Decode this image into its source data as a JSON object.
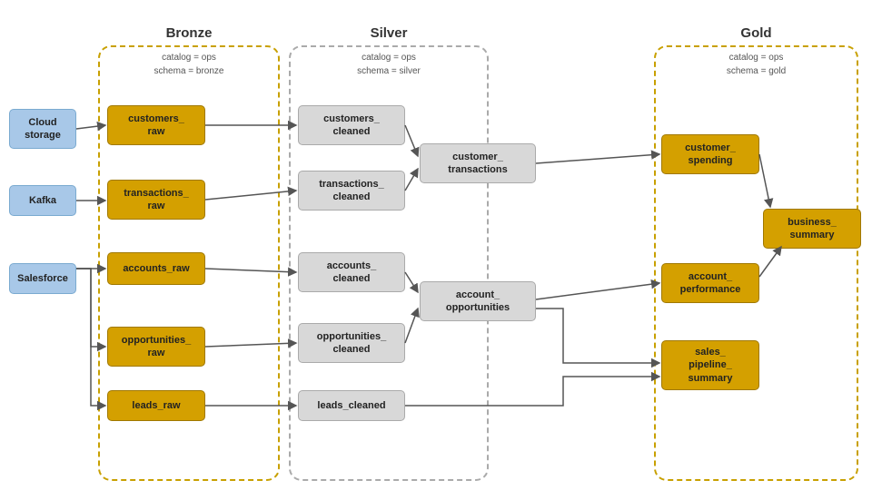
{
  "zones": {
    "bronze": {
      "title": "Bronze",
      "subtitle_line1": "catalog = ops",
      "subtitle_line2": "schema = bronze"
    },
    "silver": {
      "title": "Silver",
      "subtitle_line1": "catalog = ops",
      "subtitle_line2": "schema = silver"
    },
    "gold": {
      "title": "Gold",
      "subtitle_line1": "catalog = ops",
      "subtitle_line2": "schema = gold"
    }
  },
  "sources": [
    {
      "id": "cloud_storage",
      "label": "Cloud\nstorage"
    },
    {
      "id": "kafka",
      "label": "Kafka"
    },
    {
      "id": "salesforce",
      "label": "Salesforce"
    }
  ],
  "bronze_nodes": [
    {
      "id": "customers_raw",
      "label": "customers_\nraw"
    },
    {
      "id": "transactions_raw",
      "label": "transactions_\nraw"
    },
    {
      "id": "accounts_raw",
      "label": "accounts_raw"
    },
    {
      "id": "opportunities_raw",
      "label": "opportunities_\nraw"
    },
    {
      "id": "leads_raw",
      "label": "leads_raw"
    }
  ],
  "silver_nodes": [
    {
      "id": "customers_cleaned",
      "label": "customers_\ncleaned"
    },
    {
      "id": "transactions_cleaned",
      "label": "transactions_\ncleaned"
    },
    {
      "id": "customer_transactions",
      "label": "customer_\ntransactions"
    },
    {
      "id": "accounts_cleaned",
      "label": "accounts_\ncleaned"
    },
    {
      "id": "opportunities_cleaned",
      "label": "opportunities_\ncleaned"
    },
    {
      "id": "account_opportunities",
      "label": "account_\nopportunities"
    },
    {
      "id": "leads_cleaned",
      "label": "leads_cleaned"
    }
  ],
  "gold_nodes": [
    {
      "id": "customer_spending",
      "label": "customer_\nspending"
    },
    {
      "id": "business_summary",
      "label": "business_\nsummary"
    },
    {
      "id": "account_performance",
      "label": "account_\nperformance"
    },
    {
      "id": "sales_pipeline_summary",
      "label": "sales_\npipeline_\nsummary"
    }
  ]
}
